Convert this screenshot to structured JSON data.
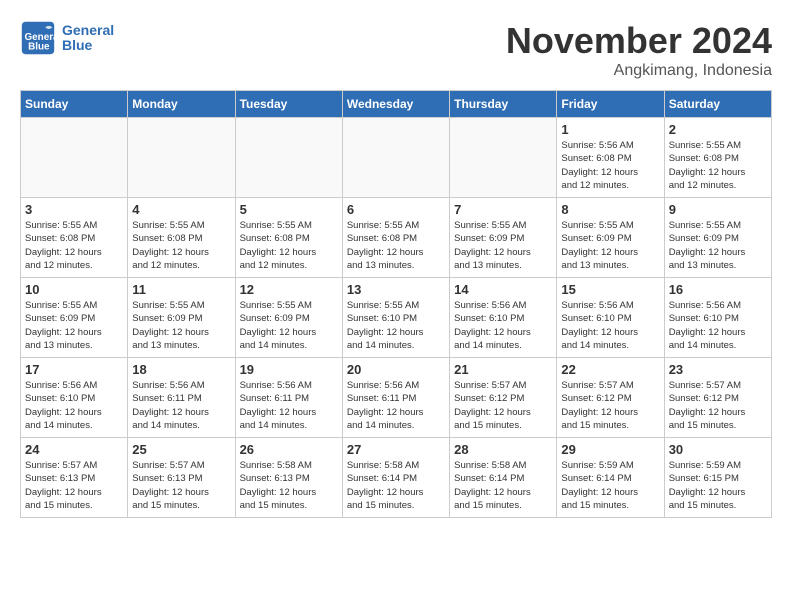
{
  "header": {
    "logo_line1": "General",
    "logo_line2": "Blue",
    "month": "November 2024",
    "location": "Angkimang, Indonesia"
  },
  "days_of_week": [
    "Sunday",
    "Monday",
    "Tuesday",
    "Wednesday",
    "Thursday",
    "Friday",
    "Saturday"
  ],
  "weeks": [
    [
      {
        "day": "",
        "info": ""
      },
      {
        "day": "",
        "info": ""
      },
      {
        "day": "",
        "info": ""
      },
      {
        "day": "",
        "info": ""
      },
      {
        "day": "",
        "info": ""
      },
      {
        "day": "1",
        "info": "Sunrise: 5:56 AM\nSunset: 6:08 PM\nDaylight: 12 hours\nand 12 minutes."
      },
      {
        "day": "2",
        "info": "Sunrise: 5:55 AM\nSunset: 6:08 PM\nDaylight: 12 hours\nand 12 minutes."
      }
    ],
    [
      {
        "day": "3",
        "info": "Sunrise: 5:55 AM\nSunset: 6:08 PM\nDaylight: 12 hours\nand 12 minutes."
      },
      {
        "day": "4",
        "info": "Sunrise: 5:55 AM\nSunset: 6:08 PM\nDaylight: 12 hours\nand 12 minutes."
      },
      {
        "day": "5",
        "info": "Sunrise: 5:55 AM\nSunset: 6:08 PM\nDaylight: 12 hours\nand 12 minutes."
      },
      {
        "day": "6",
        "info": "Sunrise: 5:55 AM\nSunset: 6:08 PM\nDaylight: 12 hours\nand 13 minutes."
      },
      {
        "day": "7",
        "info": "Sunrise: 5:55 AM\nSunset: 6:09 PM\nDaylight: 12 hours\nand 13 minutes."
      },
      {
        "day": "8",
        "info": "Sunrise: 5:55 AM\nSunset: 6:09 PM\nDaylight: 12 hours\nand 13 minutes."
      },
      {
        "day": "9",
        "info": "Sunrise: 5:55 AM\nSunset: 6:09 PM\nDaylight: 12 hours\nand 13 minutes."
      }
    ],
    [
      {
        "day": "10",
        "info": "Sunrise: 5:55 AM\nSunset: 6:09 PM\nDaylight: 12 hours\nand 13 minutes."
      },
      {
        "day": "11",
        "info": "Sunrise: 5:55 AM\nSunset: 6:09 PM\nDaylight: 12 hours\nand 13 minutes."
      },
      {
        "day": "12",
        "info": "Sunrise: 5:55 AM\nSunset: 6:09 PM\nDaylight: 12 hours\nand 14 minutes."
      },
      {
        "day": "13",
        "info": "Sunrise: 5:55 AM\nSunset: 6:10 PM\nDaylight: 12 hours\nand 14 minutes."
      },
      {
        "day": "14",
        "info": "Sunrise: 5:56 AM\nSunset: 6:10 PM\nDaylight: 12 hours\nand 14 minutes."
      },
      {
        "day": "15",
        "info": "Sunrise: 5:56 AM\nSunset: 6:10 PM\nDaylight: 12 hours\nand 14 minutes."
      },
      {
        "day": "16",
        "info": "Sunrise: 5:56 AM\nSunset: 6:10 PM\nDaylight: 12 hours\nand 14 minutes."
      }
    ],
    [
      {
        "day": "17",
        "info": "Sunrise: 5:56 AM\nSunset: 6:10 PM\nDaylight: 12 hours\nand 14 minutes."
      },
      {
        "day": "18",
        "info": "Sunrise: 5:56 AM\nSunset: 6:11 PM\nDaylight: 12 hours\nand 14 minutes."
      },
      {
        "day": "19",
        "info": "Sunrise: 5:56 AM\nSunset: 6:11 PM\nDaylight: 12 hours\nand 14 minutes."
      },
      {
        "day": "20",
        "info": "Sunrise: 5:56 AM\nSunset: 6:11 PM\nDaylight: 12 hours\nand 14 minutes."
      },
      {
        "day": "21",
        "info": "Sunrise: 5:57 AM\nSunset: 6:12 PM\nDaylight: 12 hours\nand 15 minutes."
      },
      {
        "day": "22",
        "info": "Sunrise: 5:57 AM\nSunset: 6:12 PM\nDaylight: 12 hours\nand 15 minutes."
      },
      {
        "day": "23",
        "info": "Sunrise: 5:57 AM\nSunset: 6:12 PM\nDaylight: 12 hours\nand 15 minutes."
      }
    ],
    [
      {
        "day": "24",
        "info": "Sunrise: 5:57 AM\nSunset: 6:13 PM\nDaylight: 12 hours\nand 15 minutes."
      },
      {
        "day": "25",
        "info": "Sunrise: 5:57 AM\nSunset: 6:13 PM\nDaylight: 12 hours\nand 15 minutes."
      },
      {
        "day": "26",
        "info": "Sunrise: 5:58 AM\nSunset: 6:13 PM\nDaylight: 12 hours\nand 15 minutes."
      },
      {
        "day": "27",
        "info": "Sunrise: 5:58 AM\nSunset: 6:14 PM\nDaylight: 12 hours\nand 15 minutes."
      },
      {
        "day": "28",
        "info": "Sunrise: 5:58 AM\nSunset: 6:14 PM\nDaylight: 12 hours\nand 15 minutes."
      },
      {
        "day": "29",
        "info": "Sunrise: 5:59 AM\nSunset: 6:14 PM\nDaylight: 12 hours\nand 15 minutes."
      },
      {
        "day": "30",
        "info": "Sunrise: 5:59 AM\nSunset: 6:15 PM\nDaylight: 12 hours\nand 15 minutes."
      }
    ]
  ]
}
